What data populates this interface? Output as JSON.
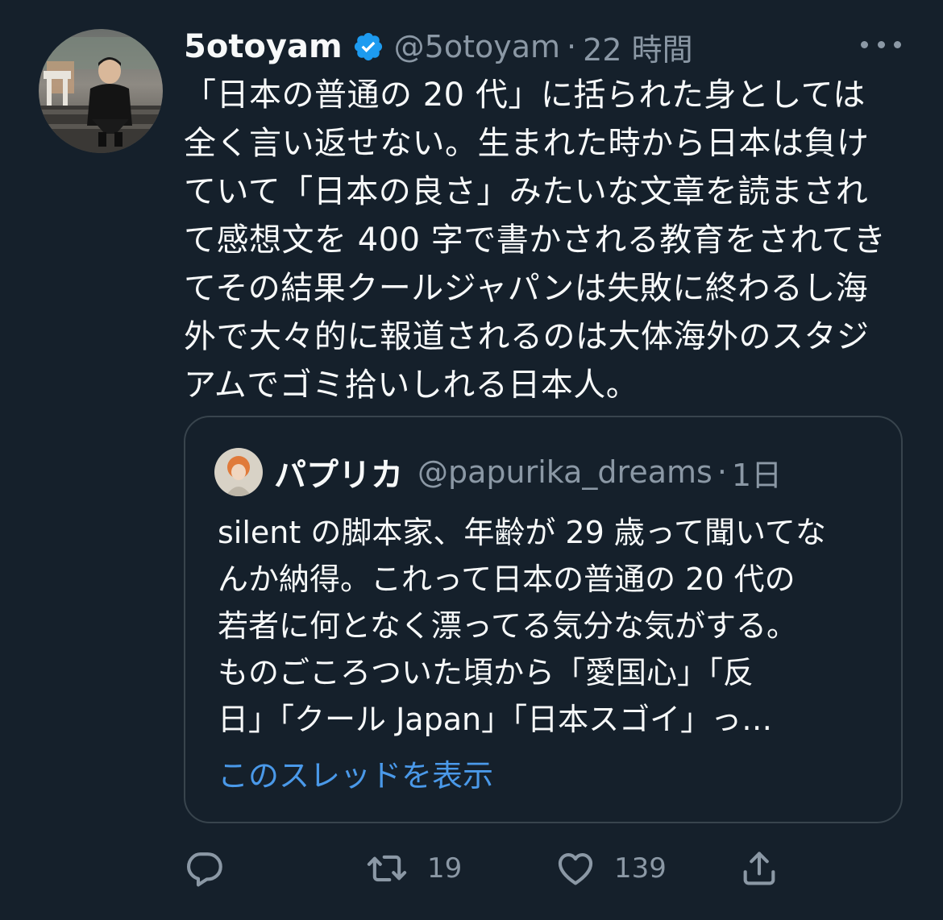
{
  "tweet": {
    "author": {
      "display_name": "5otoyam",
      "verified": true,
      "handle": "@5otoyam",
      "time": "22 時間"
    },
    "separator": "·",
    "body_lines": [
      "「日本の普通の 20 代」に括られた身としては",
      "全く言い返せない。生まれた時から日本は負け",
      "ていて「日本の良さ」みたいな文章を読まされ",
      "て感想文を 400 字で書かされる教育をされてき",
      "てその結果クールジャパンは失敗に終わるし海",
      "外で大々的に報道されるのは大体海外のスタジ",
      "アムでゴミ拾いしれる日本人。"
    ],
    "quoted": {
      "display_name": "パプリカ",
      "handle": "@papurika_dreams",
      "time": "1日",
      "body_lines": [
        "silent の脚本家、年齢が 29 歳って聞いてな",
        "んか納得。これって日本の普通の 20 代の",
        "若者に何となく漂ってる気分な気がする。",
        "ものごころついた頃から「愛国心」「反",
        "日」「クール Japan」「日本スゴイ」っ…"
      ],
      "show_thread": "このスレッドを表示"
    },
    "actions": {
      "reply_count": "",
      "retweet_count": "19",
      "like_count": "139"
    }
  },
  "colors": {
    "background": "#15202b",
    "text_primary": "#f7f9f9",
    "text_secondary": "#8b98a5",
    "link": "#4a99e9",
    "verified_badge": "#1d9bf0",
    "border": "#38444d"
  },
  "icons": {
    "verified": "verified-badge-icon",
    "more": "more-dots-icon",
    "reply": "reply-bubble-icon",
    "retweet": "retweet-icon",
    "like": "heart-icon",
    "share": "share-upload-icon"
  }
}
